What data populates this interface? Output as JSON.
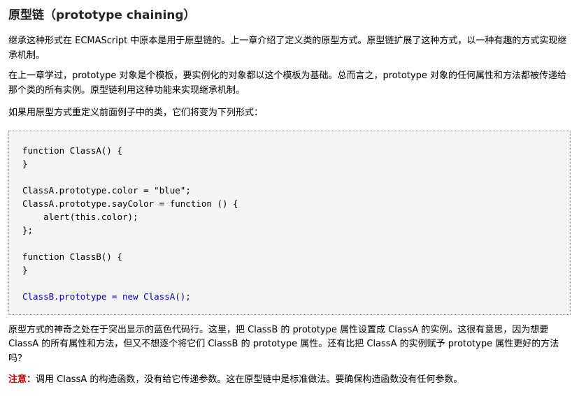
{
  "title": "原型链（prototype chaining）",
  "paragraphs": {
    "intro": "继承这种形式在 ECMAScript 中原本是用于原型链的。上一章介绍了定义类的原型方式。原型链扩展了这种方式，以一种有趣的方式实现继承机制。",
    "explain": "在上一章学过，prototype 对象是个模板，要实例化的对象都以这个模板为基础。总而言之，prototype 对象的任何属性和方法都被传递给那个类的所有实例。原型链利用这种功能来实现继承机制。",
    "lead": "如果用原型方式重定义前面例子中的类，它们将变为下列形式：",
    "after": "原型方式的神奇之处在于突出显示的蓝色代码行。这里，把 ClassB 的 prototype 属性设置成 ClassA 的实例。这很有意思，因为想要 ClassA 的所有属性和方法，但又不想逐个将它们 ClassB 的 prototype 属性。还有比把 ClassA 的实例赋予 prototype 属性更好的方法吗？"
  },
  "code": {
    "lines": [
      "function ClassA() {",
      "}",
      "",
      "ClassA.prototype.color = \"blue\";",
      "ClassA.prototype.sayColor = function () {",
      "    alert(this.color);",
      "};",
      "",
      "function ClassB() {",
      "}",
      "",
      "ClassB.prototype = new ClassA();"
    ]
  },
  "note": {
    "label": "注意：",
    "text": "调用 ClassA 的构造函数，没有给它传递参数。这在原型链中是标准做法。要确保构造函数没有任何参数。"
  },
  "colors": {
    "highlight": "#0000cc",
    "note_label": "#d00000",
    "code_background": "#f5f5f5"
  }
}
